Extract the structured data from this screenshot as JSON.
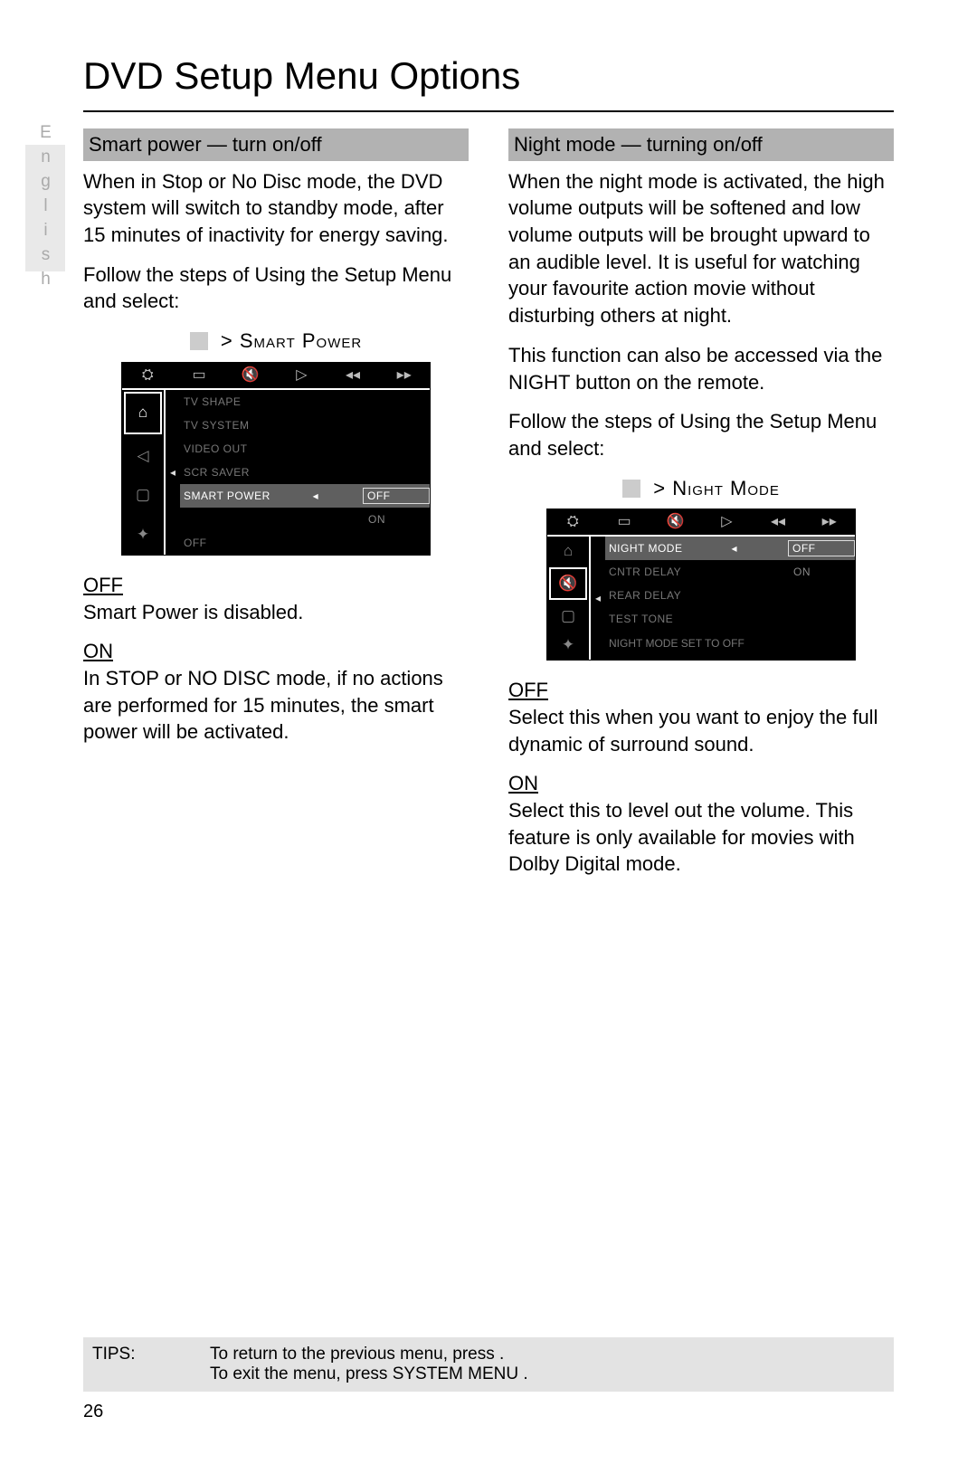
{
  "page": {
    "title": "DVD Setup Menu Options",
    "language_tab": "English",
    "number": "26"
  },
  "left": {
    "header": "Smart power — turn on/off",
    "intro": "When in  Stop  or  No Disc  mode, the DVD system will switch to standby mode, after 15 minutes of inactivity for energy saving.",
    "steps": "Follow the steps of  Using the Setup Menu  and select:",
    "breadcrumb": ">  Smart  Power",
    "off_label": "OFF",
    "off_text": "Smart Power is disabled.",
    "on_label": "ON",
    "on_text": "In STOP or NO DISC mode, if no actions are performed for 15 minutes, the smart power will be activated.",
    "osd": {
      "rows": [
        {
          "label": "TV SHAPE"
        },
        {
          "label": "TV SYSTEM"
        },
        {
          "label": "VIDEO OUT"
        },
        {
          "label": "SCR SAVER"
        },
        {
          "label": "SMART POWER",
          "selected": true,
          "val": "OFF",
          "val2": "ON"
        },
        {
          "label": "OFF"
        }
      ]
    }
  },
  "right": {
    "header": "Night mode — turning on/off",
    "intro": "When the night mode is activated, the high volume outputs will be softened and low volume outputs will be brought upward to an audible level.  It is useful for watching your favourite action movie without disturbing others at night.",
    "intro2": "This function can also be accessed via the NIGHT button on the remote.",
    "steps": "Follow the steps of  Using the Setup Menu  and select:",
    "breadcrumb": ">  Night  Mode",
    "off_label": "OFF",
    "off_text": "Select this when you want to enjoy the full dynamic of surround sound.",
    "on_label": "ON",
    "on_text": "Select this to level out the volume. This feature is only available for movies with Dolby Digital mode.",
    "osd": {
      "rows": [
        {
          "label": "NIGHT MODE",
          "selected": true,
          "val": "OFF",
          "val2": "ON"
        },
        {
          "label": "CNTR DELAY"
        },
        {
          "label": "REAR DELAY"
        },
        {
          "label": "TEST TONE"
        }
      ],
      "status": "NIGHT MODE SET TO OFF"
    }
  },
  "tips": {
    "label": "TIPS:",
    "line1": "To return to the previous menu, press  .",
    "line2": "To exit the menu, press SYSTEM MENU ."
  },
  "icons": {
    "settings": "⛭",
    "monitor": "▭",
    "speaker": "🔇",
    "chat": "▢",
    "lock": "✦",
    "play": "▷",
    "rew": "◂◂",
    "ffw": "▸▸",
    "globe": "⌂"
  }
}
